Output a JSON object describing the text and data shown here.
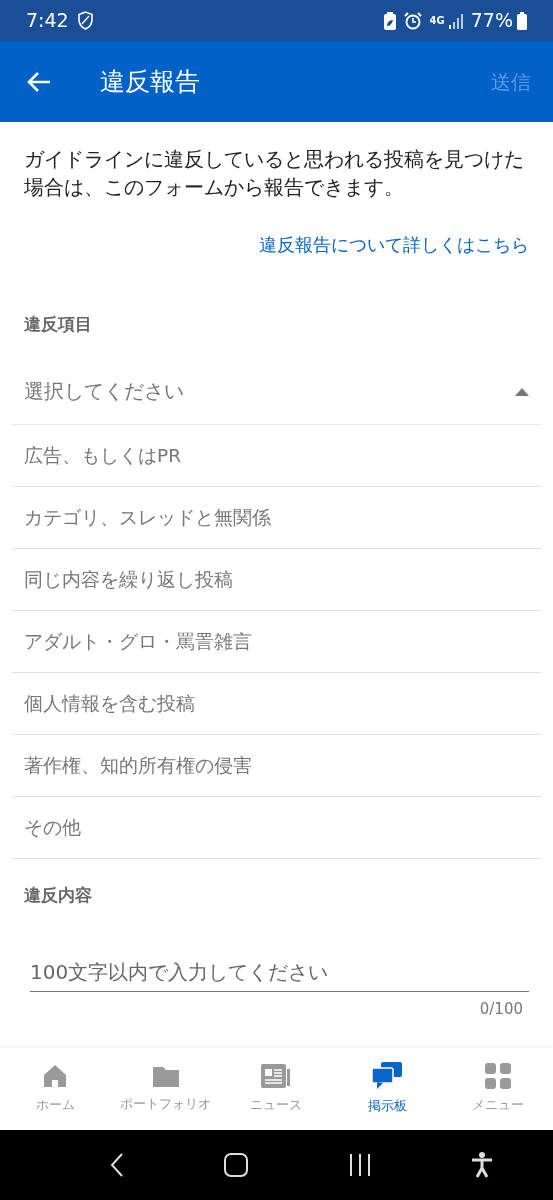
{
  "status_bar": {
    "time": "7:42",
    "battery": "77%",
    "network": "4G"
  },
  "header": {
    "title": "違反報告",
    "action": {
      "label": "送信",
      "disabled": true
    }
  },
  "intro": "ガイドラインに違反していると思われる投稿を見つけた場合は、このフォームから報告できます。",
  "help_link": "違反報告について詳しくはこちら",
  "violation_type": {
    "label": "違反項目",
    "placeholder": "選択してください",
    "expanded": true,
    "options": [
      {
        "label": "広告、もしくはPR",
        "selected": false
      },
      {
        "label": "カテゴリ、スレッドと無関係",
        "selected": false
      },
      {
        "label": "同じ内容を繰り返し投稿",
        "selected": false
      },
      {
        "label": "アダルト・グロ・罵詈雑言",
        "selected": false
      },
      {
        "label": "個人情報を含む投稿",
        "selected": false
      },
      {
        "label": "著作権、知的所有権の侵害",
        "selected": false
      },
      {
        "label": "その他",
        "selected": false
      }
    ]
  },
  "violation_content": {
    "label": "違反内容",
    "placeholder": "100文字以内で入力してください",
    "counter": "0/100"
  },
  "bottom_nav": [
    {
      "label": "ホーム",
      "selected": false
    },
    {
      "label": "ポートフォリオ",
      "selected": false
    },
    {
      "label": "ニュース",
      "selected": false
    },
    {
      "label": "掲示板",
      "selected": true
    },
    {
      "label": "メニュー",
      "selected": false
    }
  ]
}
